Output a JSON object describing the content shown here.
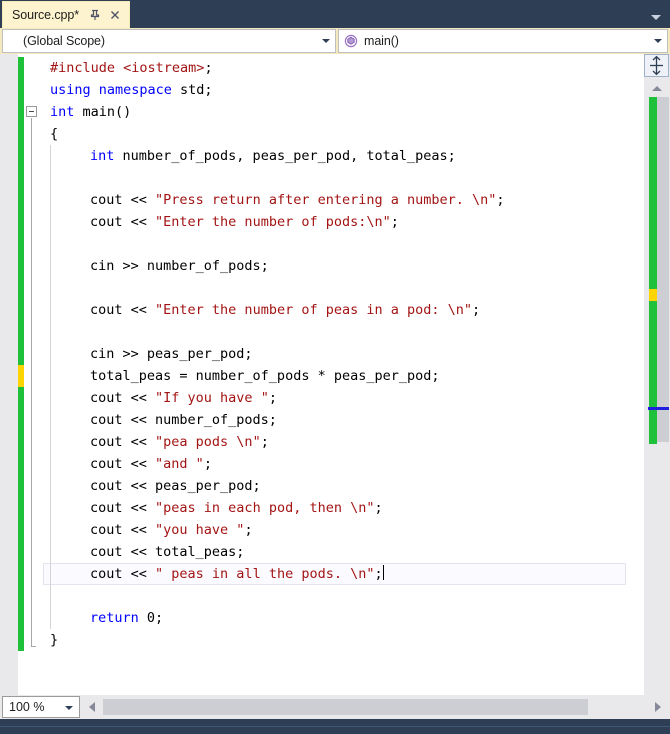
{
  "window": {
    "chrome_color": "#2d3e55",
    "tabstrip_overflow_icon": "chevron-down-icon"
  },
  "tab": {
    "title": "Source.cpp*",
    "pin_icon": "pin-icon",
    "close_icon": "close-icon",
    "active": true,
    "background": "#fdf3ce"
  },
  "navbar": {
    "scope": {
      "value": "(Global Scope)",
      "arrow_icon": "chevron-down-icon"
    },
    "member": {
      "value": "main()",
      "icon": "method-icon",
      "icon_color": "#9b72c6",
      "arrow_icon": "chevron-down-icon"
    }
  },
  "editor": {
    "language": "cpp",
    "caret_line_index": 23,
    "colors": {
      "keyword": "#0000ff",
      "string": "#a31515",
      "preprocessor": "#a31515",
      "identifier": "#000000",
      "changed_saved": "#1fc13a",
      "changed_unsaved": "#ffd400",
      "current_line_border": "#e4e4ee"
    },
    "lines": [
      {
        "indent": 0,
        "tokens": [
          {
            "t": "#include ",
            "c": "pre"
          },
          {
            "t": "<iostream>",
            "c": "pre"
          },
          {
            "t": ";",
            "c": "id"
          }
        ]
      },
      {
        "indent": 0,
        "tokens": [
          {
            "t": "using namespace",
            "c": "kw"
          },
          {
            "t": " std;",
            "c": "id"
          }
        ]
      },
      {
        "indent": 0,
        "tokens": [
          {
            "t": "int",
            "c": "kw"
          },
          {
            "t": " main()",
            "c": "id"
          }
        ]
      },
      {
        "indent": 0,
        "tokens": [
          {
            "t": "{",
            "c": "id"
          }
        ]
      },
      {
        "indent": 1,
        "tokens": [
          {
            "t": "int",
            "c": "kw"
          },
          {
            "t": " number_of_pods, peas_per_pod, total_peas;",
            "c": "id"
          }
        ]
      },
      {
        "indent": 1,
        "tokens": []
      },
      {
        "indent": 1,
        "tokens": [
          {
            "t": "cout << ",
            "c": "id"
          },
          {
            "t": "\"Press return after entering a number. \\n\"",
            "c": "str"
          },
          {
            "t": ";",
            "c": "id"
          }
        ]
      },
      {
        "indent": 1,
        "tokens": [
          {
            "t": "cout << ",
            "c": "id"
          },
          {
            "t": "\"Enter the number of pods:\\n\"",
            "c": "str"
          },
          {
            "t": ";",
            "c": "id"
          }
        ]
      },
      {
        "indent": 1,
        "tokens": []
      },
      {
        "indent": 1,
        "tokens": [
          {
            "t": "cin >> number_of_pods;",
            "c": "id"
          }
        ]
      },
      {
        "indent": 1,
        "tokens": []
      },
      {
        "indent": 1,
        "tokens": [
          {
            "t": "cout << ",
            "c": "id"
          },
          {
            "t": "\"Enter the number of peas in a pod: \\n\"",
            "c": "str"
          },
          {
            "t": ";",
            "c": "id"
          }
        ]
      },
      {
        "indent": 1,
        "tokens": []
      },
      {
        "indent": 1,
        "tokens": [
          {
            "t": "cin >> peas_per_pod;",
            "c": "id"
          }
        ]
      },
      {
        "indent": 1,
        "tokens": [
          {
            "t": "total_peas = number_of_pods * peas_per_pod;",
            "c": "id"
          }
        ]
      },
      {
        "indent": 1,
        "tokens": [
          {
            "t": "cout << ",
            "c": "id"
          },
          {
            "t": "\"If you have \"",
            "c": "str"
          },
          {
            "t": ";",
            "c": "id"
          }
        ]
      },
      {
        "indent": 1,
        "tokens": [
          {
            "t": "cout << number_of_pods;",
            "c": "id"
          }
        ]
      },
      {
        "indent": 1,
        "tokens": [
          {
            "t": "cout << ",
            "c": "id"
          },
          {
            "t": "\"pea pods \\n\"",
            "c": "str"
          },
          {
            "t": ";",
            "c": "id"
          }
        ]
      },
      {
        "indent": 1,
        "tokens": [
          {
            "t": "cout << ",
            "c": "id"
          },
          {
            "t": "\"and \"",
            "c": "str"
          },
          {
            "t": ";",
            "c": "id"
          }
        ]
      },
      {
        "indent": 1,
        "tokens": [
          {
            "t": "cout << peas_per_pod;",
            "c": "id"
          }
        ]
      },
      {
        "indent": 1,
        "tokens": [
          {
            "t": "cout << ",
            "c": "id"
          },
          {
            "t": "\"peas in each pod, then \\n\"",
            "c": "str"
          },
          {
            "t": ";",
            "c": "id"
          }
        ]
      },
      {
        "indent": 1,
        "tokens": [
          {
            "t": "cout << ",
            "c": "id"
          },
          {
            "t": "\"you have \"",
            "c": "str"
          },
          {
            "t": ";",
            "c": "id"
          }
        ]
      },
      {
        "indent": 1,
        "tokens": [
          {
            "t": "cout << total_peas;",
            "c": "id"
          }
        ]
      },
      {
        "indent": 1,
        "tokens": [
          {
            "t": "cout << ",
            "c": "id"
          },
          {
            "t": "\" peas in all the pods. \\n\"",
            "c": "str"
          },
          {
            "t": ";",
            "c": "id"
          }
        ]
      },
      {
        "indent": 1,
        "tokens": []
      },
      {
        "indent": 1,
        "tokens": [
          {
            "t": "return",
            "c": "kw"
          },
          {
            "t": " 0;",
            "c": "id"
          }
        ]
      },
      {
        "indent": 0,
        "tokens": [
          {
            "t": "}",
            "c": "id"
          }
        ]
      }
    ],
    "change_bars": [
      {
        "from_line": 0,
        "to_line": 13,
        "state": "saved"
      },
      {
        "from_line": 14,
        "to_line": 14,
        "state": "unsaved"
      },
      {
        "from_line": 15,
        "to_line": 26,
        "state": "saved"
      }
    ],
    "fold_marker": {
      "line": 2,
      "state": "expanded",
      "icon": "collapse-minus-icon"
    }
  },
  "vertical_scrollbar": {
    "split_button_icon": "split-view-icon",
    "up_arrow_icon": "chevron-up-icon",
    "annotation_green_color": "#1fc13a",
    "annotation_yellow_color": "#ffd400",
    "caret_marker_color": "#1f1fe0"
  },
  "bottombar": {
    "zoom": {
      "value": "100 %",
      "arrow_icon": "chevron-down-icon"
    },
    "hscroll": {
      "left_arrow_icon": "chevron-left-icon",
      "right_arrow_icon": "chevron-right-icon"
    }
  }
}
